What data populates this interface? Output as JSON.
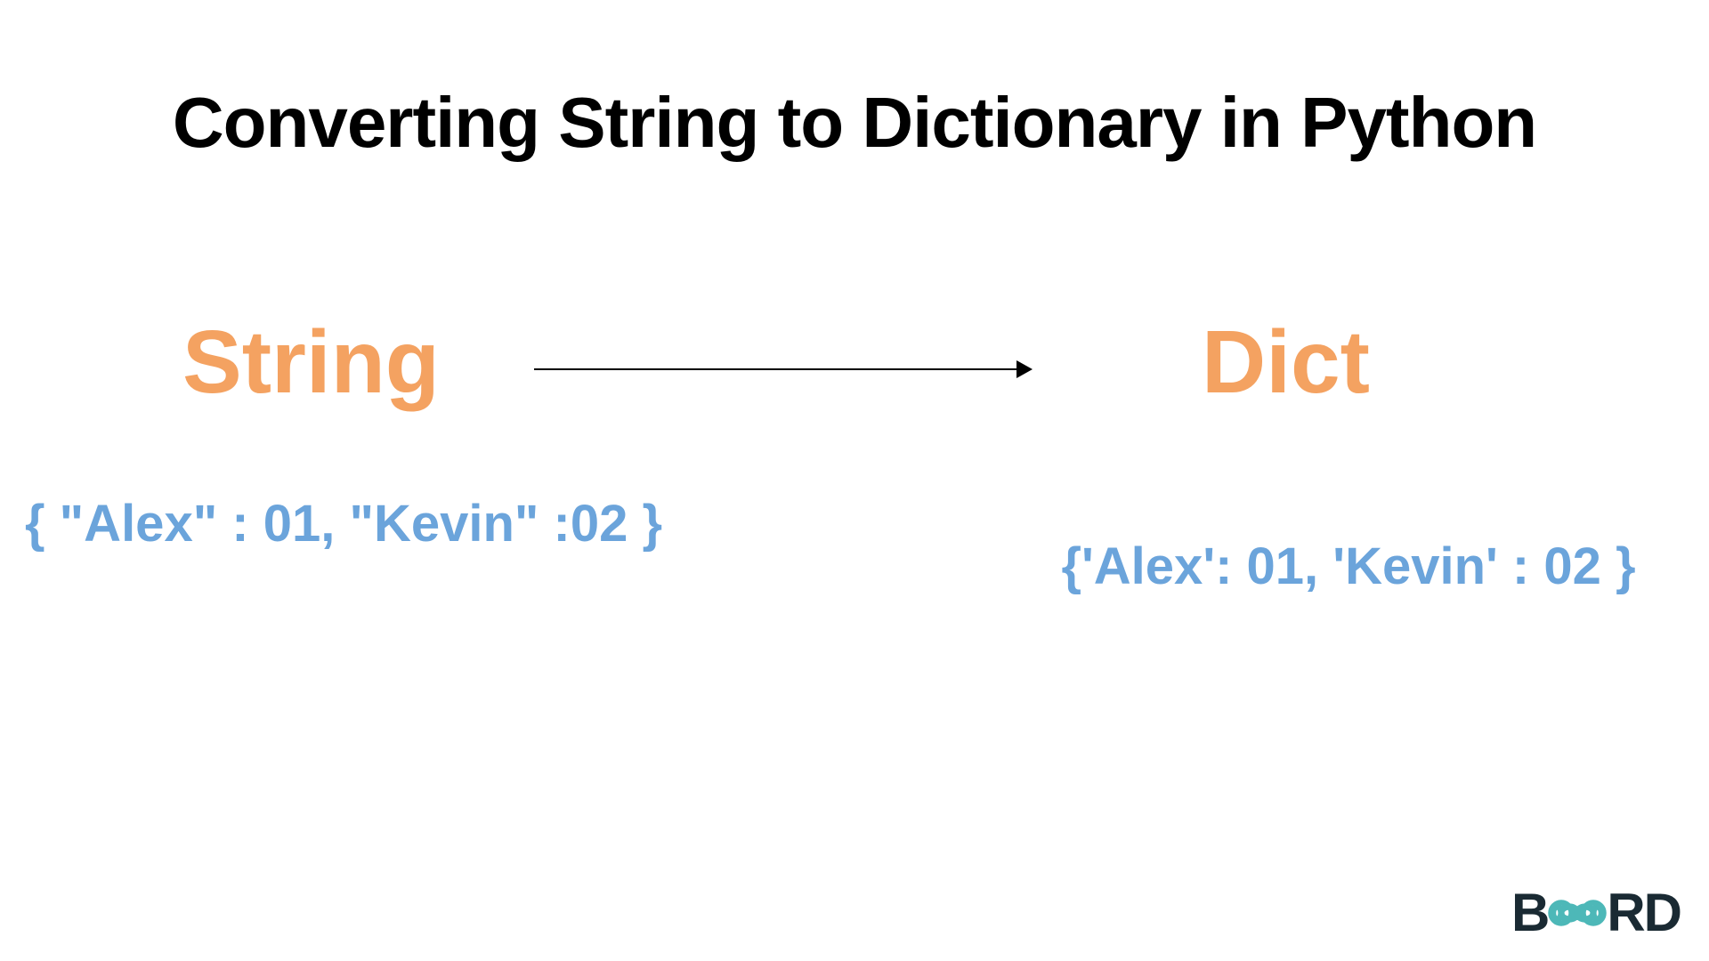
{
  "title": "Converting String to Dictionary in Python",
  "left": {
    "label": "String",
    "example": "{ \"Alex\" : 01, \"Kevin\" :02 }"
  },
  "right": {
    "label": "Dict",
    "example": "{'Alex': 01, 'Kevin' : 02 }"
  },
  "logo": {
    "part1": "B",
    "part2": "RD"
  }
}
